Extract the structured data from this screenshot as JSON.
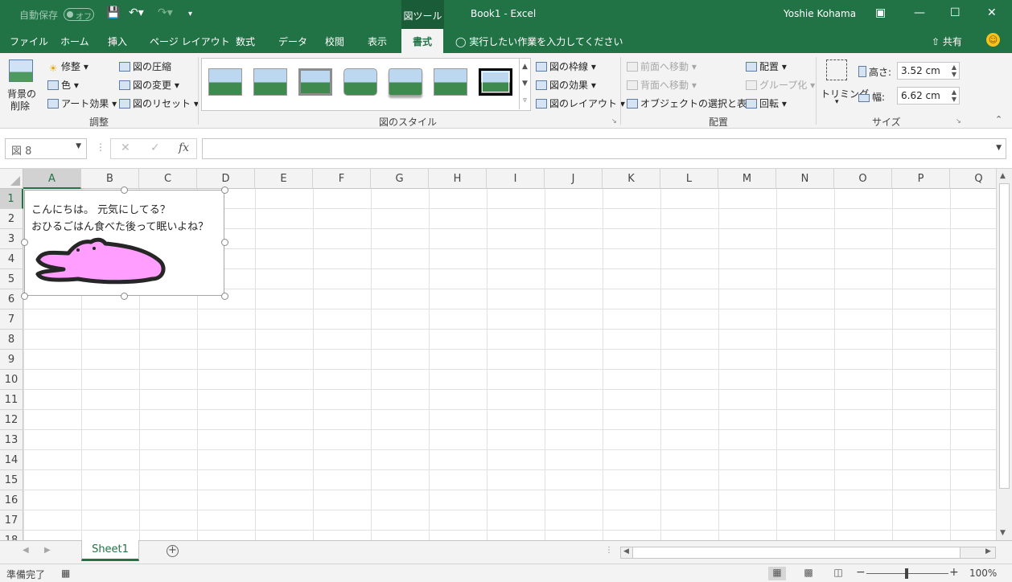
{
  "titlebar": {
    "autosave_label": "自動保存",
    "autosave_state": "オフ",
    "context_tool": "図ツール",
    "doc_title": "Book1  -  Excel",
    "user": "Yoshie Kohama"
  },
  "tabs": [
    "ファイル",
    "ホーム",
    "挿入",
    "ページ レイアウト",
    "数式",
    "データ",
    "校閲",
    "表示",
    "書式"
  ],
  "active_tab": "書式",
  "tell_me": "実行したい作業を入力してください",
  "share_label": "共有",
  "ribbon": {
    "adjust": {
      "remove_bg_line1": "背景の",
      "remove_bg_line2": "削除",
      "corrections": "修整",
      "color": "色",
      "artistic": "アート効果",
      "compress": "図の圧縮",
      "change": "図の変更",
      "reset": "図のリセット",
      "group_label": "調整"
    },
    "styles": {
      "border": "図の枠線",
      "effects": "図の効果",
      "layout": "図のレイアウト",
      "group_label": "図のスタイル"
    },
    "arrange": {
      "bring_forward": "前面へ移動",
      "send_backward": "背面へ移動",
      "selection_pane": "オブジェクトの選択と表示",
      "align": "配置",
      "group": "グループ化",
      "rotate": "回転",
      "group_label": "配置"
    },
    "size": {
      "crop": "トリミング",
      "height_label": "高さ:",
      "height_value": "3.52 cm",
      "width_label": "幅:",
      "width_value": "6.62 cm",
      "group_label": "サイズ"
    }
  },
  "formula_bar": {
    "name_box": "図 8",
    "cancel": "✕",
    "enter": "✓",
    "fx": "fx",
    "content": ""
  },
  "columns": [
    "A",
    "B",
    "C",
    "D",
    "E",
    "F",
    "G",
    "H",
    "I",
    "J",
    "K",
    "L",
    "M",
    "N",
    "O",
    "P",
    "Q"
  ],
  "rows": [
    "1",
    "2",
    "3",
    "4",
    "5",
    "6",
    "7",
    "8",
    "9",
    "10",
    "11",
    "12",
    "13",
    "14",
    "15",
    "16",
    "17",
    "18"
  ],
  "picture": {
    "line1": "こんにちは。 元気にしてる？",
    "line2": "おひるごはん食べた後って眠いよね？",
    "fill_color": "#ff9eff",
    "outline_color": "#262626"
  },
  "sheet_tab": "Sheet1",
  "status": {
    "ready": "準備完了",
    "zoom": "100%"
  },
  "colors": {
    "accent": "#217346"
  }
}
